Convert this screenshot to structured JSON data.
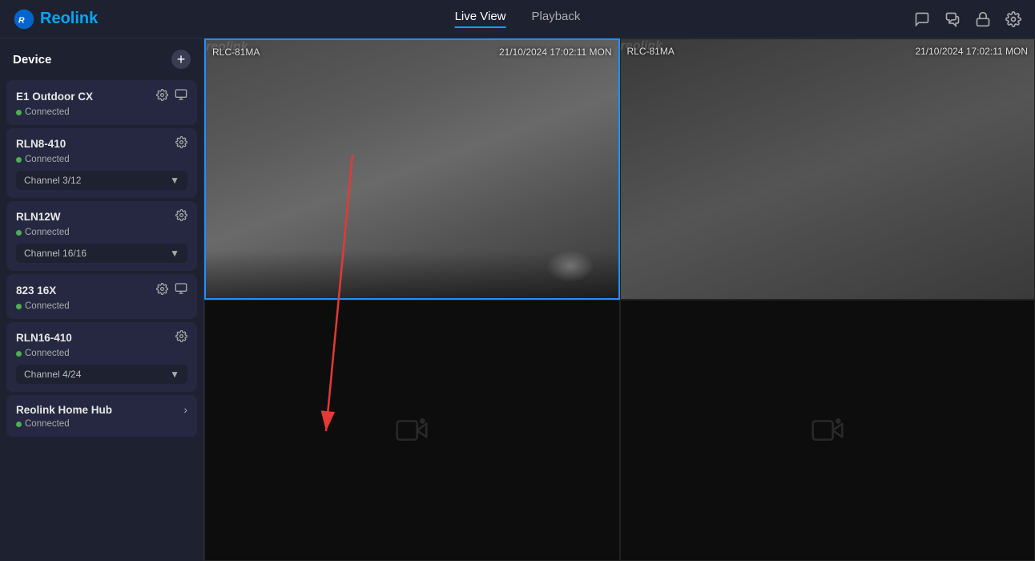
{
  "header": {
    "logo_text": "Reolink",
    "nav": [
      {
        "label": "Live View",
        "active": true
      },
      {
        "label": "Playback",
        "active": false
      }
    ],
    "icons": [
      {
        "name": "message-icon",
        "symbol": "💬"
      },
      {
        "name": "chat-icon",
        "symbol": "🗨"
      },
      {
        "name": "lock-icon",
        "symbol": "🔒"
      },
      {
        "name": "settings-icon",
        "symbol": "⚙"
      }
    ]
  },
  "sidebar": {
    "title": "Device",
    "add_label": "+",
    "devices": [
      {
        "id": "e1-outdoor-cx",
        "name": "E1 Outdoor CX",
        "status": "Connected",
        "has_settings": true,
        "has_extra_icon": true,
        "has_channel": false
      },
      {
        "id": "rln8-410",
        "name": "RLN8-410",
        "status": "Connected",
        "has_settings": true,
        "has_extra_icon": false,
        "has_channel": true,
        "channel": "Channel 3/12"
      },
      {
        "id": "rln12w",
        "name": "RLN12W",
        "status": "Connected",
        "has_settings": true,
        "has_extra_icon": false,
        "has_channel": true,
        "channel": "Channel 16/16"
      },
      {
        "id": "823-16x",
        "name": "823 16X",
        "status": "Connected",
        "has_settings": true,
        "has_extra_icon": true,
        "has_channel": false
      },
      {
        "id": "rln16-410",
        "name": "RLN16-410",
        "status": "Connected",
        "has_settings": true,
        "has_extra_icon": false,
        "has_channel": true,
        "channel": "Channel 4/24"
      },
      {
        "id": "reolink-home-hub",
        "name": "Reolink Home Hub",
        "status": "Connected",
        "has_settings": false,
        "has_extra_icon": false,
        "has_channel": false,
        "has_arrow": true
      }
    ]
  },
  "main": {
    "cells": [
      {
        "id": "cell-1",
        "active": true,
        "has_feed": true,
        "model": "RLC-81MA",
        "datetime": "21/10/2024 17:02:11 MON",
        "watermark": "reolink"
      },
      {
        "id": "cell-2",
        "active": false,
        "has_feed": true,
        "model": "RLC-81MA",
        "datetime": "21/10/2024 17:02:11 MON",
        "watermark": "reolink"
      },
      {
        "id": "cell-3",
        "active": false,
        "has_feed": false
      },
      {
        "id": "cell-4",
        "active": false,
        "has_feed": false
      }
    ]
  }
}
